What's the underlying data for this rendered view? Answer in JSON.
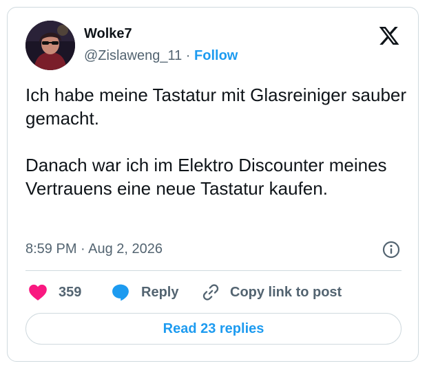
{
  "author": {
    "display_name": "Wolke7",
    "handle": "@Zislaweng_11",
    "separator": "·",
    "follow_label": "Follow",
    "avatar_icon": "profile-avatar"
  },
  "tweet": {
    "text_lines": [
      "Ich habe meine Tastatur mit Glasreiniger sauber gemacht.",
      "Danach war ich im Elektro Discounter meines Vertrauens eine neue Tastatur kaufen."
    ],
    "timestamp": "8:59 PM · Aug 2, 2026"
  },
  "actions": {
    "like_count": "359",
    "reply_label": "Reply",
    "copy_link_label": "Copy link to post",
    "read_replies_label": "Read 23 replies"
  },
  "icons": {
    "brand": "x-logo-icon",
    "info": "info-icon",
    "like": "heart-icon",
    "reply": "speech-bubble-icon",
    "copy": "link-icon"
  },
  "colors": {
    "accent": "#1d9bf0",
    "like": "#f91880",
    "text_primary": "#0f1419",
    "text_secondary": "#536471",
    "border": "#cfd9de"
  }
}
